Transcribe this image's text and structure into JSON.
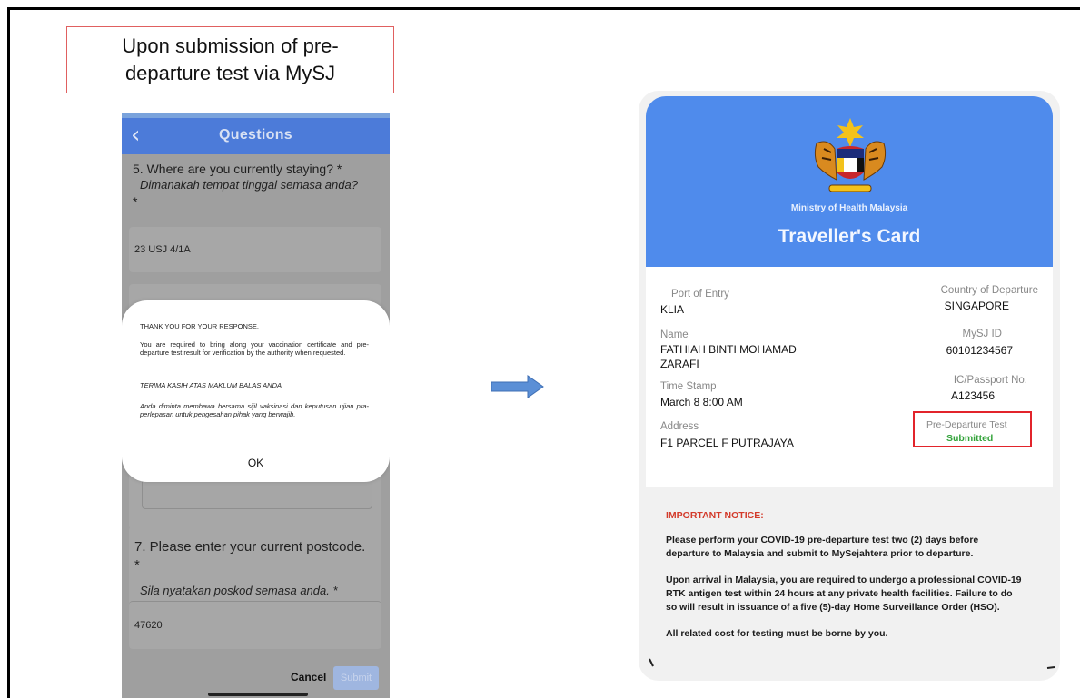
{
  "caption": {
    "line1": "Upon submission of pre-",
    "line2": "departure test via MySJ"
  },
  "phone": {
    "header_title": "Questions",
    "q5_text": "5. Where are you currently staying? *",
    "q5_italic": "Dimanakah tempat tinggal semasa anda?",
    "q5_star": "*",
    "q5_answer": "23 USJ 4/1A",
    "q7_text": "7. Please enter your current postcode.",
    "q7_star": "*",
    "q7_italic": "Sila nyatakan poskod semasa anda. *",
    "q7_answer": "47620",
    "cancel_label": "Cancel",
    "submit_label": "Submit",
    "dialog": {
      "line1": "THANK YOU FOR YOUR RESPONSE.",
      "line2": "You are required to bring along your vaccination certificate and pre-departure test result for verification by the authority when requested.",
      "line3": "TERIMA KASIH ATAS MAKLUM BALAS ANDA",
      "line4": "Anda diminta membawa bersama sijil vaksinasi dan keputusan ujian pra-perlepasan untuk pengesahan pihak yang berwajib.",
      "ok_label": "OK"
    }
  },
  "card": {
    "ministry": "Ministry of Health Malaysia",
    "title": "Traveller's Card",
    "port_label": "Port of Entry",
    "port_value": "KLIA",
    "country_label": "Country of Departure",
    "country_value": "SINGAPORE",
    "name_label": "Name",
    "name_line1": "FATHIAH BINTI MOHAMAD",
    "name_line2": "ZARAFI",
    "mysj_label": "MySJ ID",
    "mysj_value": "60101234567",
    "ic_label": "IC/Passport No.",
    "ic_value": "A123456",
    "timestamp_label": "Time Stamp",
    "timestamp_value": "March 8  8:00 AM",
    "address_label": "Address",
    "address_value": "F1 PARCEL F PUTRAJAYA",
    "pdt_label": "Pre-Departure Test",
    "pdt_value": "Submitted",
    "notice_title": "IMPORTANT NOTICE:",
    "notice_p1_l1": "Please perform your COVID-19 pre-departure test two (2) days before",
    "notice_p1_l2": "departure to Malaysia and submit to MySejahtera prior to departure.",
    "notice_p2_l1": "Upon arrival in Malaysia, you are required to undergo a professional COVID-19",
    "notice_p2_l2": "RTK antigen test within 24 hours at any private health facilities. Failure to do",
    "notice_p2_l3": "so will result in issuance of a five (5)-day Home Surveillance Order (HSO).",
    "notice_p3": "All related cost for testing must be borne by you."
  },
  "colors": {
    "header_blue": "#4f8bec",
    "app_blue": "#4c7bd9",
    "highlight_red": "#e2242b",
    "status_green": "#33a33a",
    "notice_red": "#d33a2a"
  },
  "icons": {
    "back": "chevron-left-icon",
    "arrow": "arrow-right-icon",
    "crest": "malaysia-coat-of-arms-icon"
  }
}
